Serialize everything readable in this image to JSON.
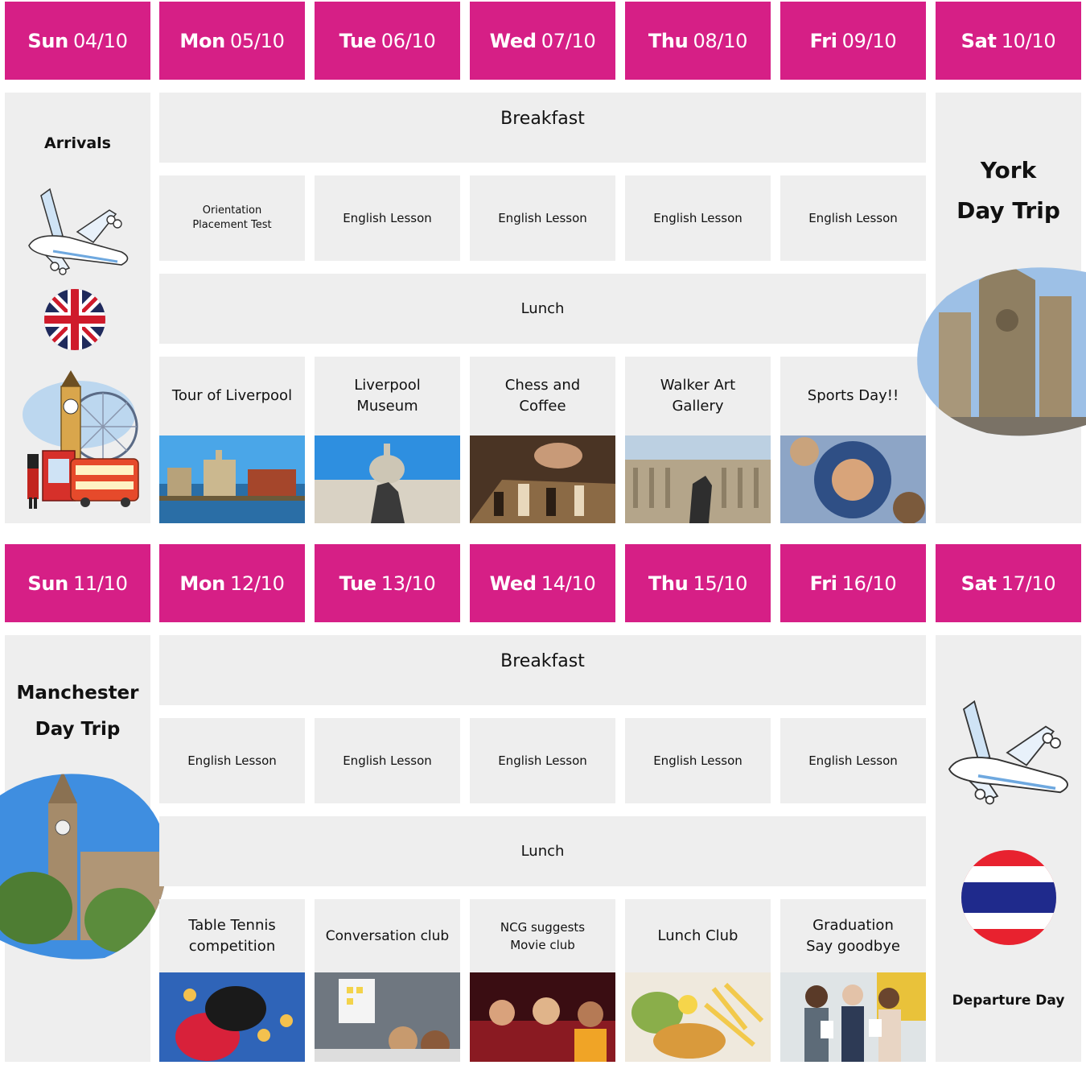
{
  "week1": {
    "days": [
      {
        "day": "Sun",
        "date": "04/10"
      },
      {
        "day": "Mon",
        "date": "05/10"
      },
      {
        "day": "Tue",
        "date": "06/10"
      },
      {
        "day": "Wed",
        "date": "07/10"
      },
      {
        "day": "Thu",
        "date": "08/10"
      },
      {
        "day": "Fri",
        "date": "09/10"
      },
      {
        "day": "Sat",
        "date": "10/10"
      }
    ],
    "left_title": "Arrivals",
    "breakfast": "Breakfast",
    "morning": [
      {
        "line1": "Orientation",
        "line2": "Placement Test"
      },
      {
        "line1": "English Lesson",
        "line2": ""
      },
      {
        "line1": "English Lesson",
        "line2": ""
      },
      {
        "line1": "English Lesson",
        "line2": ""
      },
      {
        "line1": "English Lesson",
        "line2": ""
      }
    ],
    "lunch": "Lunch",
    "afternoon": [
      {
        "line1": "Tour of Liverpool",
        "line2": ""
      },
      {
        "line1": "Liverpool",
        "line2": "Museum"
      },
      {
        "line1": "Chess and",
        "line2": "Coffee"
      },
      {
        "line1": "Walker Art",
        "line2": "Gallery"
      },
      {
        "line1": "Sports Day!!",
        "line2": ""
      }
    ],
    "right_title": {
      "line1": "York",
      "line2": "Day Trip"
    }
  },
  "week2": {
    "days": [
      {
        "day": "Sun",
        "date": "11/10"
      },
      {
        "day": "Mon",
        "date": "12/10"
      },
      {
        "day": "Tue",
        "date": "13/10"
      },
      {
        "day": "Wed",
        "date": "14/10"
      },
      {
        "day": "Thu",
        "date": "15/10"
      },
      {
        "day": "Fri",
        "date": "16/10"
      },
      {
        "day": "Sat",
        "date": "17/10"
      }
    ],
    "left_title": {
      "line1": "Manchester",
      "line2": "Day Trip"
    },
    "breakfast": "Breakfast",
    "morning": [
      {
        "line1": "English Lesson",
        "line2": ""
      },
      {
        "line1": "English Lesson",
        "line2": ""
      },
      {
        "line1": "English Lesson",
        "line2": ""
      },
      {
        "line1": "English Lesson",
        "line2": ""
      },
      {
        "line1": "English Lesson",
        "line2": ""
      }
    ],
    "lunch": "Lunch",
    "afternoon": [
      {
        "line1": "Table Tennis",
        "line2": "competition"
      },
      {
        "line1": "Conversation club",
        "line2": ""
      },
      {
        "line1": "NCG suggests",
        "line2": "Movie club"
      },
      {
        "line1": "Lunch Club",
        "line2": ""
      },
      {
        "line1": "Graduation",
        "line2": "Say goodbye"
      }
    ],
    "right_title": "Departure Day"
  },
  "colors": {
    "header": "#d61f86",
    "cell": "#eeeeee"
  },
  "icons": [
    "airplane-icon",
    "union-jack-flag-icon",
    "london-landmarks-illustration",
    "thailand-flag-icon"
  ]
}
